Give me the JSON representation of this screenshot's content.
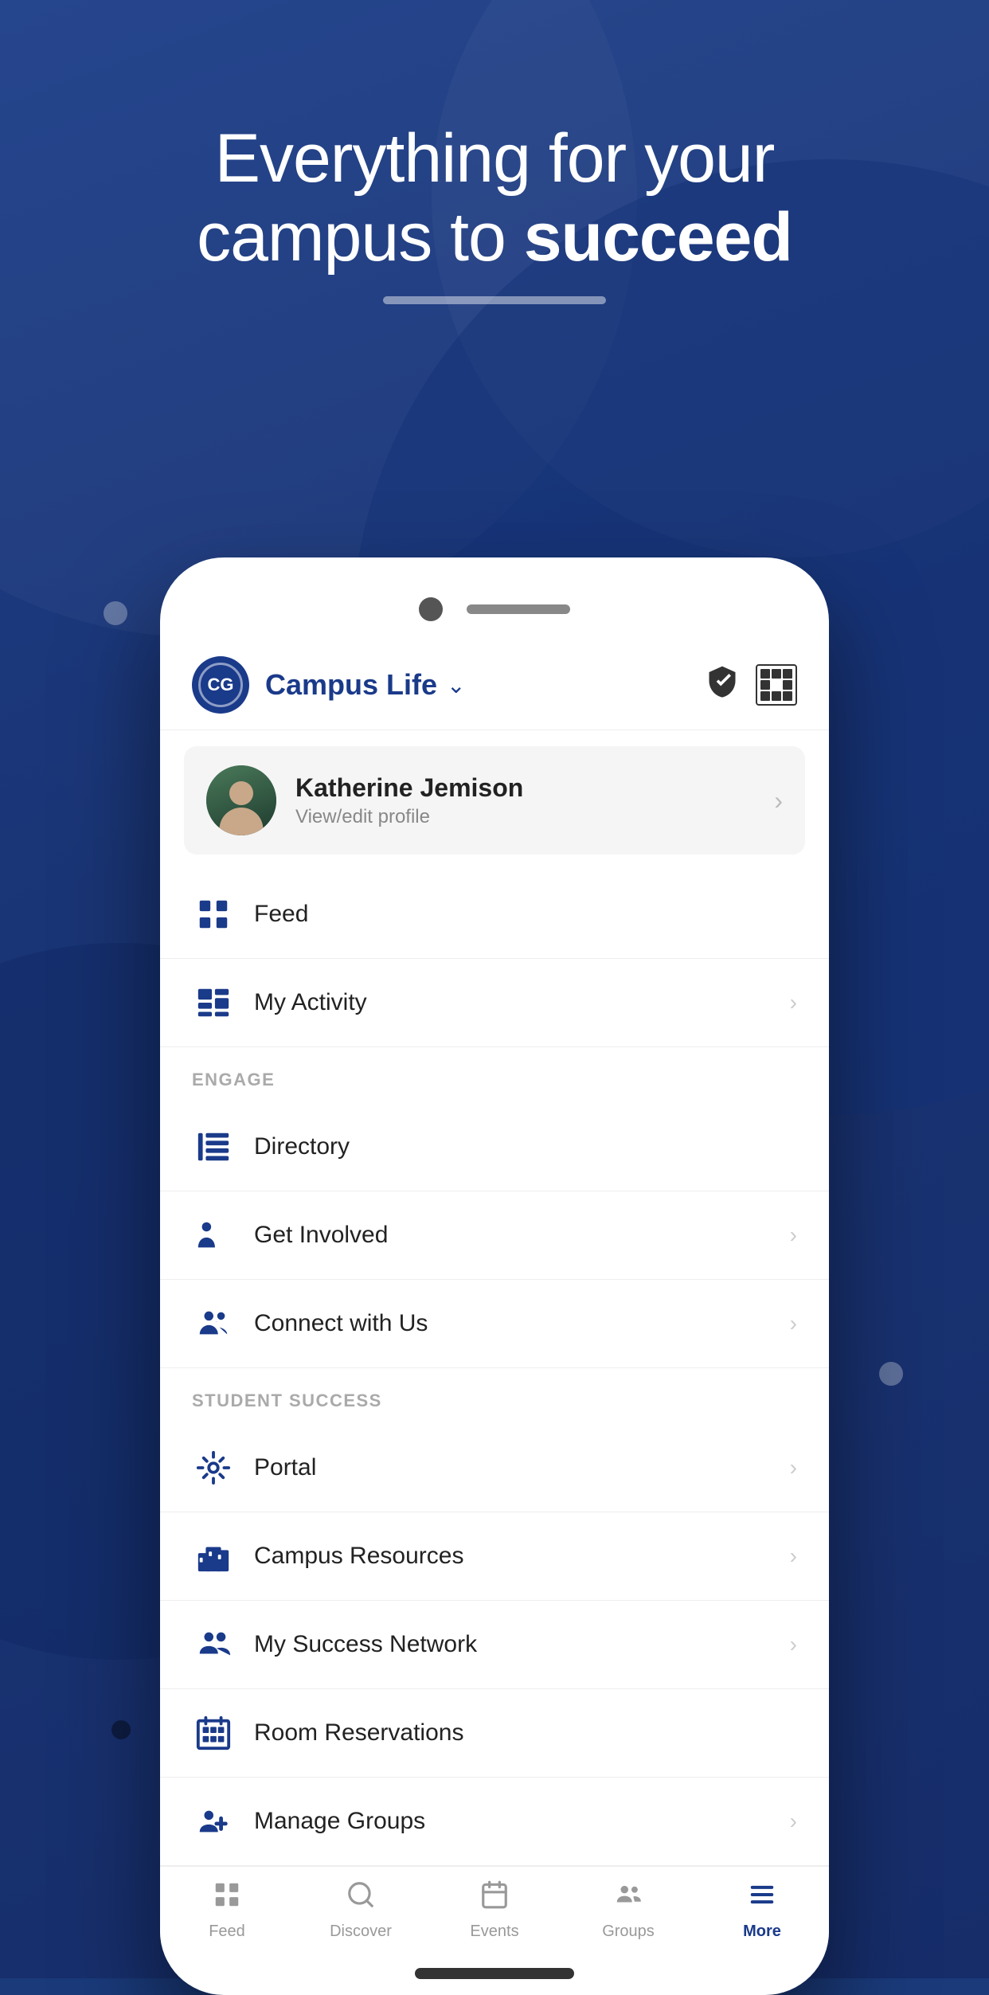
{
  "background": {
    "color": "#1a3575"
  },
  "hero": {
    "line1": "Everything for your",
    "line2": "campus to ",
    "line2_bold": "succeed"
  },
  "app": {
    "logo_text": "CG",
    "name": "Campus Life",
    "shield_label": "shield",
    "qr_label": "qr-code"
  },
  "profile": {
    "name": "Katherine Jemison",
    "subtitle": "View/edit profile"
  },
  "menu_items": [
    {
      "id": "feed",
      "label": "Feed",
      "icon": "feed",
      "has_chevron": false
    },
    {
      "id": "my-activity",
      "label": "My Activity",
      "icon": "activity",
      "has_chevron": true
    }
  ],
  "sections": [
    {
      "id": "engage",
      "header": "ENGAGE",
      "items": [
        {
          "id": "directory",
          "label": "Directory",
          "icon": "directory",
          "has_chevron": false
        },
        {
          "id": "get-involved",
          "label": "Get Involved",
          "icon": "get-involved",
          "has_chevron": true
        },
        {
          "id": "connect-with-us",
          "label": "Connect with Us",
          "icon": "connect",
          "has_chevron": true
        }
      ]
    },
    {
      "id": "student-success",
      "header": "STUDENT SUCCESS",
      "items": [
        {
          "id": "portal",
          "label": "Portal",
          "icon": "portal",
          "has_chevron": true
        },
        {
          "id": "campus-resources",
          "label": "Campus Resources",
          "icon": "campus-resources",
          "has_chevron": true
        },
        {
          "id": "my-success-network",
          "label": "My Success Network",
          "icon": "success-network",
          "has_chevron": true
        },
        {
          "id": "room-reservations",
          "label": "Room Reservations",
          "icon": "room-reservations",
          "has_chevron": false
        },
        {
          "id": "manage-groups",
          "label": "Manage Groups",
          "icon": "manage-groups",
          "has_chevron": true
        }
      ]
    }
  ],
  "tab_bar": {
    "items": [
      {
        "id": "feed",
        "label": "Feed",
        "icon": "feed",
        "active": false
      },
      {
        "id": "discover",
        "label": "Discover",
        "icon": "discover",
        "active": false
      },
      {
        "id": "events",
        "label": "Events",
        "icon": "events",
        "active": false
      },
      {
        "id": "groups",
        "label": "Groups",
        "icon": "groups",
        "active": false
      },
      {
        "id": "more",
        "label": "More",
        "icon": "more",
        "active": true
      }
    ]
  }
}
